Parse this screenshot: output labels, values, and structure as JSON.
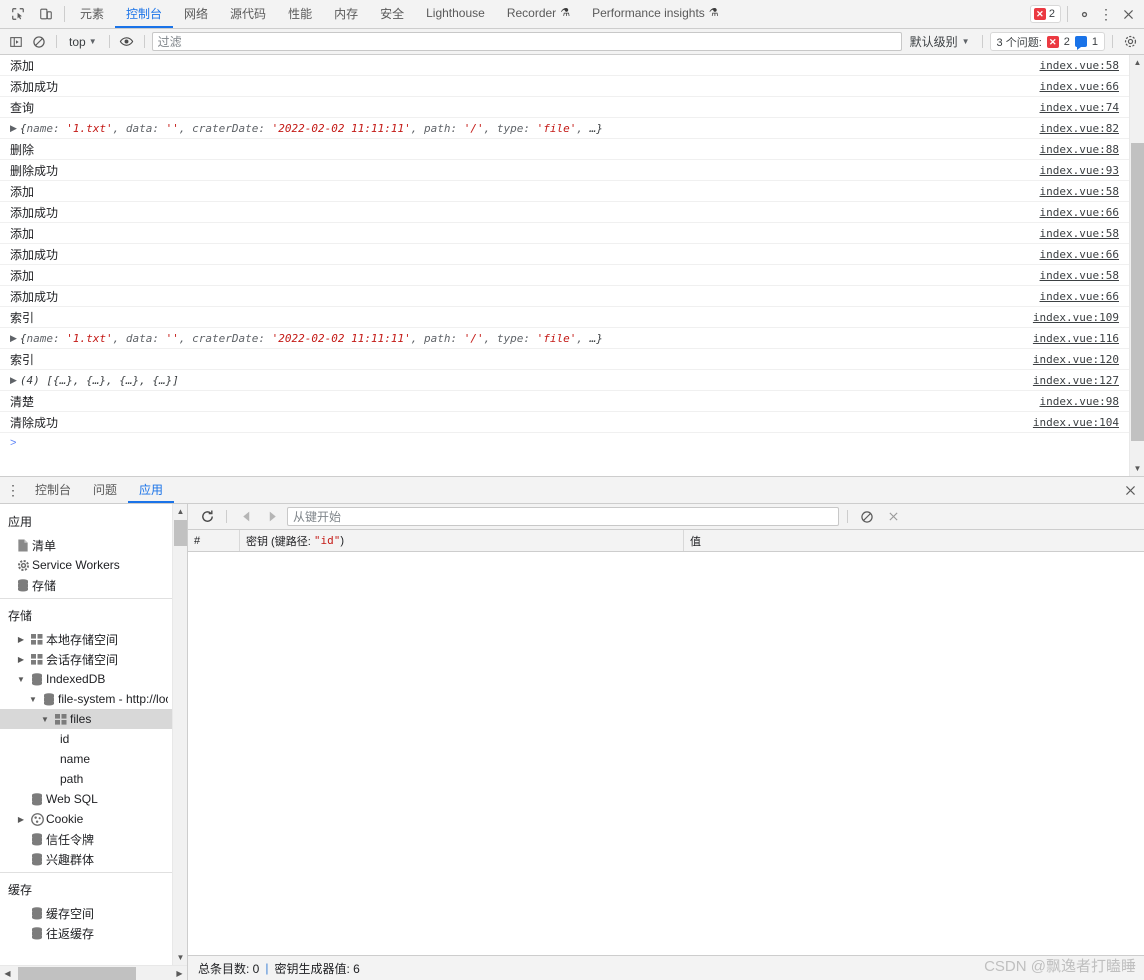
{
  "main_tabbar": {
    "inspect_icon": "inspect-cursor-icon",
    "device_icon": "device-toolbar-icon",
    "tabs": [
      {
        "label": "元素",
        "active": false,
        "flask": false
      },
      {
        "label": "控制台",
        "active": true,
        "flask": false
      },
      {
        "label": "网络",
        "active": false,
        "flask": false
      },
      {
        "label": "源代码",
        "active": false,
        "flask": false
      },
      {
        "label": "性能",
        "active": false,
        "flask": false
      },
      {
        "label": "内存",
        "active": false,
        "flask": false
      },
      {
        "label": "安全",
        "active": false,
        "flask": false
      },
      {
        "label": "Lighthouse",
        "active": false,
        "flask": false
      },
      {
        "label": "Recorder",
        "active": false,
        "flask": true
      },
      {
        "label": "Performance insights",
        "active": false,
        "flask": true
      }
    ],
    "error_count": "2",
    "settings_icon": "gear-icon",
    "more_icon": "kebab-menu-icon",
    "close_icon": "close-icon"
  },
  "console_toolbar": {
    "sidebar_toggle_icon": "console-sidebar-toggle-icon",
    "clear_icon": "clear-console-icon",
    "context": "top",
    "eye_icon": "live-expression-eye-icon",
    "filter_placeholder": "过滤",
    "filter_value": "",
    "level": "默认级别",
    "issues_text": "3 个问题:",
    "issues_errors": "2",
    "issues_info": "1",
    "settings_icon": "console-settings-gear-icon"
  },
  "console_messages": [
    {
      "type": "text",
      "text": "添加",
      "source": "index.vue:58"
    },
    {
      "type": "text",
      "text": "添加成功",
      "source": "index.vue:66"
    },
    {
      "type": "text",
      "text": "查询",
      "source": "index.vue:74"
    },
    {
      "type": "object",
      "text": "",
      "source": "index.vue:82"
    },
    {
      "type": "text",
      "text": "删除",
      "source": "index.vue:88"
    },
    {
      "type": "text",
      "text": "删除成功",
      "source": "index.vue:93"
    },
    {
      "type": "text",
      "text": "添加",
      "source": "index.vue:58"
    },
    {
      "type": "text",
      "text": "添加成功",
      "source": "index.vue:66"
    },
    {
      "type": "text",
      "text": "添加",
      "source": "index.vue:58"
    },
    {
      "type": "text",
      "text": "添加成功",
      "source": "index.vue:66"
    },
    {
      "type": "text",
      "text": "添加",
      "source": "index.vue:58"
    },
    {
      "type": "text",
      "text": "添加成功",
      "source": "index.vue:66"
    },
    {
      "type": "text",
      "text": "索引",
      "source": "index.vue:109"
    },
    {
      "type": "object",
      "text": "",
      "source": "index.vue:116"
    },
    {
      "type": "text",
      "text": "索引",
      "source": "index.vue:120"
    },
    {
      "type": "array",
      "text": "",
      "source": "index.vue:127"
    },
    {
      "type": "text",
      "text": "清楚",
      "source": "index.vue:98"
    },
    {
      "type": "text",
      "text": "清除成功",
      "source": "index.vue:104"
    }
  ],
  "object_preview": {
    "open": "{",
    "k_name": "name:",
    "v_name": "'1.txt'",
    "k_data": "data:",
    "v_data": "''",
    "k_date": "craterDate:",
    "v_date": "'2022-02-02 11:11:11'",
    "k_path": "path:",
    "v_path": "'/'",
    "k_type": "type:",
    "v_type": "'file'",
    "ellipsis": "…}"
  },
  "array_preview": {
    "count": "(4)",
    "body": "[{…}, {…}, {…}, {…}]"
  },
  "prompt": ">",
  "drawer": {
    "menu_icon": "drawer-more-icon",
    "tabs": [
      {
        "label": "控制台",
        "active": false
      },
      {
        "label": "问题",
        "active": false
      },
      {
        "label": "应用",
        "active": true
      }
    ],
    "close_icon": "drawer-close-icon"
  },
  "sidebar": {
    "section_application": "应用",
    "application_items": [
      {
        "label": "清单",
        "icon": "manifest-document-icon"
      },
      {
        "label": "Service Workers",
        "icon": "gear-icon"
      },
      {
        "label": "存储",
        "icon": "database-stack-icon"
      }
    ],
    "section_storage": "存储",
    "storage_items": [
      {
        "label": "本地存储空间",
        "icon": "table-grid-icon",
        "twisty": "collapsed",
        "indent": 0,
        "selected": false
      },
      {
        "label": "会话存储空间",
        "icon": "table-grid-icon",
        "twisty": "collapsed",
        "indent": 0,
        "selected": false
      },
      {
        "label": "IndexedDB",
        "icon": "database-stack-icon",
        "twisty": "expanded",
        "indent": 0,
        "selected": false
      },
      {
        "label": "file-system - http://local",
        "icon": "database-stack-icon",
        "twisty": "expanded",
        "indent": 1,
        "selected": false
      },
      {
        "label": "files",
        "icon": "table-grid-icon",
        "twisty": "expanded",
        "indent": 2,
        "selected": true
      },
      {
        "label": "id",
        "icon": "none",
        "twisty": "none",
        "indent": 3,
        "selected": false
      },
      {
        "label": "name",
        "icon": "none",
        "twisty": "none",
        "indent": 3,
        "selected": false
      },
      {
        "label": "path",
        "icon": "none",
        "twisty": "none",
        "indent": 3,
        "selected": false
      },
      {
        "label": "Web SQL",
        "icon": "database-stack-icon",
        "twisty": "none",
        "indent": 0,
        "selected": false
      },
      {
        "label": "Cookie",
        "icon": "cookie-icon",
        "twisty": "collapsed",
        "indent": 0,
        "selected": false
      },
      {
        "label": "信任令牌",
        "icon": "database-stack-icon",
        "twisty": "none",
        "indent": 0,
        "selected": false
      },
      {
        "label": "兴趣群体",
        "icon": "database-stack-icon",
        "twisty": "none",
        "indent": 0,
        "selected": false
      }
    ],
    "section_cache": "缓存",
    "cache_items": [
      {
        "label": "缓存空间",
        "icon": "database-stack-icon"
      },
      {
        "label": "往返缓存",
        "icon": "database-stack-icon"
      }
    ]
  },
  "idb": {
    "refresh_icon": "refresh-icon",
    "prev_icon": "previous-page-icon",
    "next_icon": "next-page-icon",
    "key_placeholder": "从键开始",
    "key_value": "",
    "clear_icon": "clear-object-store-icon",
    "delete_icon": "delete-selected-icon",
    "columns": {
      "num": "#",
      "key_prefix": "密钥 (键路径:",
      "key_path": "\"id\"",
      "key_suffix": ")",
      "value": "值"
    },
    "rows": [],
    "status_total_label": "总条目数: 0",
    "status_sep": "|",
    "status_generator_label": "密钥生成器值: 6"
  },
  "watermark": "CSDN @飘逸者打瞌睡"
}
